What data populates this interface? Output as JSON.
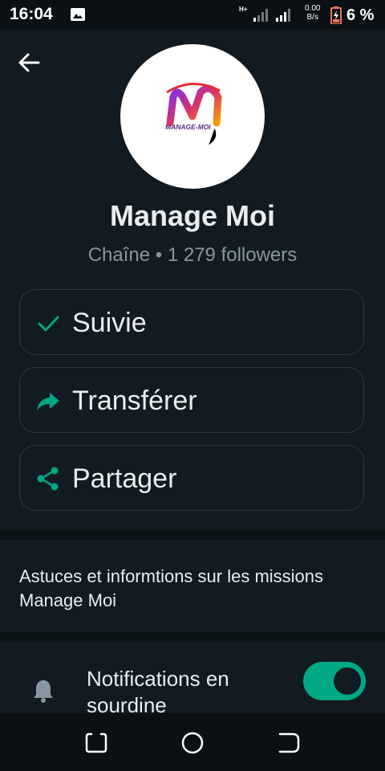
{
  "status_bar": {
    "time": "16:04",
    "network_type": "H+",
    "net_speed_value": "0.00",
    "net_speed_unit": "B/s",
    "battery_percent": "6 %"
  },
  "channel": {
    "name": "Manage Moi",
    "subtitle": "Chaîne • 1 279 followers",
    "logo_text": "MANAGE-MOI"
  },
  "actions": [
    {
      "label": "Suivie",
      "icon": "check-icon"
    },
    {
      "label": "Transférer",
      "icon": "forward-icon"
    },
    {
      "label": "Partager",
      "icon": "share-icon"
    }
  ],
  "description": "Astuces et informtions sur les missions Manage Moi",
  "notifications": {
    "label": "Notifications en sourdine",
    "enabled": true
  },
  "colors": {
    "background": "#121b22",
    "accent": "#00a884",
    "muted_text": "#8696a0"
  }
}
